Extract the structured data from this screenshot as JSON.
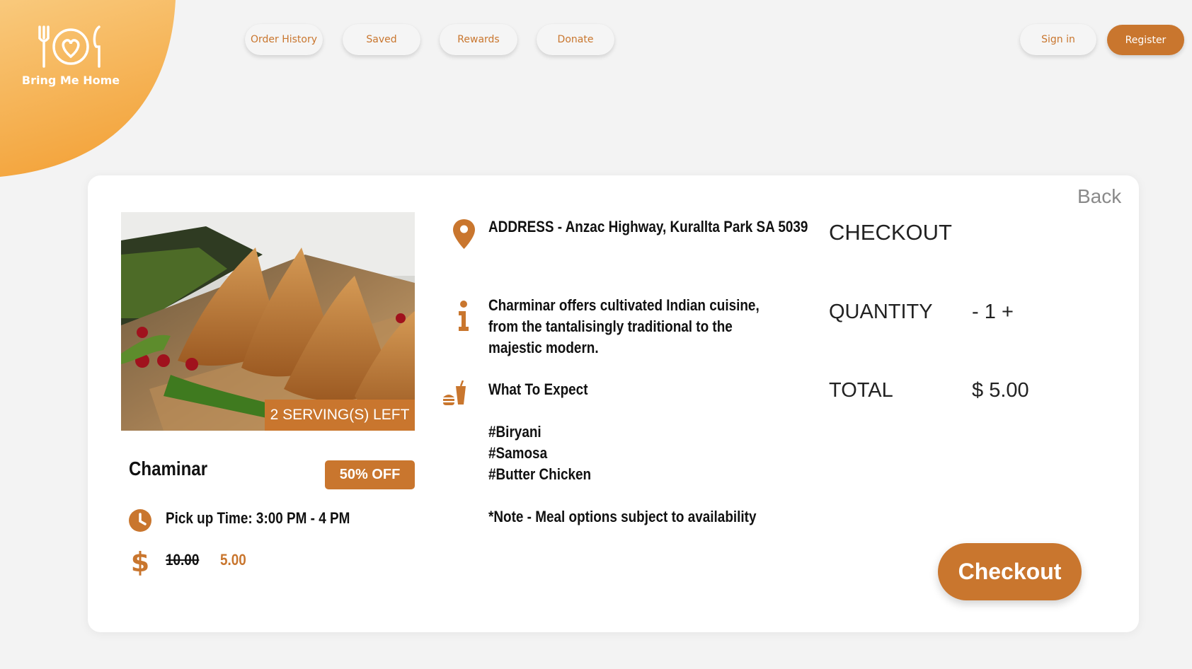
{
  "brand": {
    "name": "Bring Me Home"
  },
  "nav": {
    "order_history": "Order History",
    "saved": "Saved",
    "rewards": "Rewards",
    "donate": "Donate",
    "sign_in": "Sign in",
    "register": "Register"
  },
  "colors": {
    "accent": "#c9762e",
    "brand_gradient_start": "#f9c97c",
    "brand_gradient_end": "#f3a43c"
  },
  "card": {
    "back": "Back",
    "servings_left": "2 SERVING(S) LEFT",
    "restaurant_name": "Chaminar",
    "discount": "50% OFF",
    "pickup_time": "Pick up Time: 3:00 PM - 4 PM",
    "original_price": "10.00",
    "discounted_price": "5.00",
    "address": "ADDRESS - Anzac Highway, Kurallta Park SA 5039",
    "description": "Charminar offers cultivated Indian cuisine, from the tantalisingly traditional to the majestic modern.",
    "what_to_expect": "What To Expect",
    "tags": [
      "#Biryani",
      "#Samosa",
      "#Butter Chicken"
    ],
    "note": "*Note - Meal options subject to availability"
  },
  "checkout": {
    "title": "CHECKOUT",
    "quantity_label": "QUANTITY",
    "decrement": "-",
    "quantity": "1",
    "increment": "+",
    "total_label": "TOTAL",
    "currency": "$",
    "total": "5.00",
    "button": "Checkout"
  },
  "icons": [
    "fork-knife-heart-logo-icon",
    "map-pin-icon",
    "info-icon",
    "food-drink-icon",
    "clock-icon",
    "dollar-icon"
  ]
}
